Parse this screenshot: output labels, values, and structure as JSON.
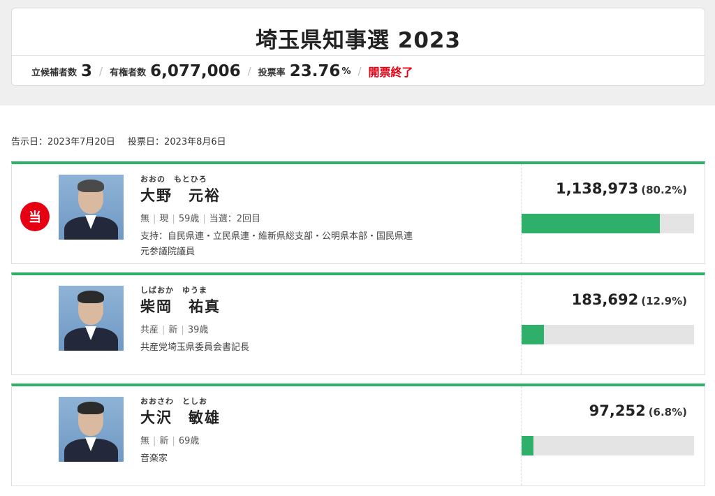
{
  "election": {
    "title": "埼玉県知事選 2023",
    "candidates_label": "立候補者数",
    "candidates_count": "3",
    "voters_label": "有権者数",
    "voters_count": "6,077,006",
    "turnout_label": "投票率",
    "turnout_value": "23.76",
    "turnout_unit": "%",
    "status": "開票終了",
    "announce_date": "告示日：2023年7月20日",
    "vote_date": "投票日：2023年8月6日"
  },
  "candidates": [
    {
      "kana": "おおの　もとひろ",
      "name": "大野　元裕",
      "party": "無",
      "type": "現",
      "age": "59歳",
      "elected_count": "当選：2回目",
      "support": "支持：自民県連・立民県連・維新県総支部・公明県本部・国民県連",
      "career": "元参議院議員",
      "votes": "1,138,973",
      "percent_label": "(80.2%)",
      "share": 80.2,
      "elected": true,
      "winner_mark": "当"
    },
    {
      "kana": "しばおか　ゆうま",
      "name": "柴岡　祐真",
      "party": "共産",
      "type": "新",
      "age": "39歳",
      "career": "共産党埼玉県委員会書記長",
      "votes": "183,692",
      "percent_label": "(12.9%)",
      "share": 12.9,
      "elected": false
    },
    {
      "kana": "おおさわ　としお",
      "name": "大沢　敏雄",
      "party": "無",
      "type": "新",
      "age": "69歳",
      "career": "音楽家",
      "votes": "97,252",
      "percent_label": "(6.8%)",
      "share": 6.8,
      "elected": false
    }
  ],
  "colors": {
    "accent": "#2fb06a",
    "winner": "#e60012",
    "bar_track": "#e4e4e4"
  }
}
